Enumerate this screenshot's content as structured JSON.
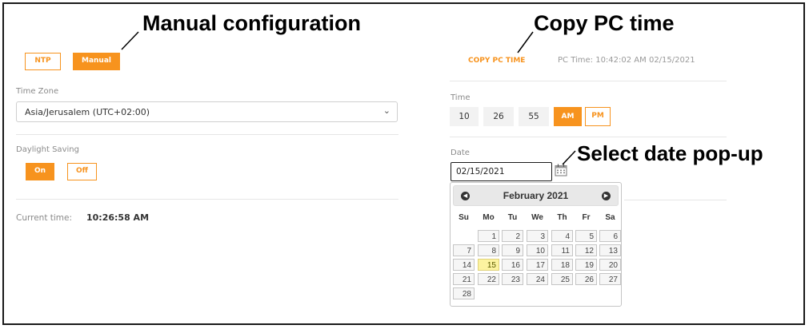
{
  "callouts": {
    "manual": "Manual configuration",
    "copy_pc": "Copy PC time",
    "date_popup": "Select date pop-up"
  },
  "mode": {
    "ntp_label": "NTP",
    "manual_label": "Manual",
    "selected": "Manual"
  },
  "timezone": {
    "label": "Time Zone",
    "value": "Asia/Jerusalem (UTC+02:00)"
  },
  "daylight": {
    "label": "Daylight Saving",
    "on_label": "On",
    "off_label": "Off",
    "selected": "On"
  },
  "current": {
    "label": "Current time:",
    "value": "10:26:58 AM"
  },
  "copy": {
    "button_label": "COPY PC TIME",
    "pc_time": "PC Time: 10:42:02 AM 02/15/2021"
  },
  "time": {
    "label": "Time",
    "hour": "10",
    "minute": "26",
    "second": "55",
    "am_label": "AM",
    "pm_label": "PM",
    "selected": "AM"
  },
  "date": {
    "label": "Date",
    "value": "02/15/2021"
  },
  "datepicker": {
    "title": "February 2021",
    "prev_icon": "circle-triangle-left-icon",
    "next_icon": "circle-triangle-right-icon",
    "weekdays": [
      "Su",
      "Mo",
      "Tu",
      "We",
      "Th",
      "Fr",
      "Sa"
    ],
    "days": [
      "1",
      "2",
      "3",
      "4",
      "5",
      "6",
      "7",
      "8",
      "9",
      "10",
      "11",
      "12",
      "13",
      "14",
      "15",
      "16",
      "17",
      "18",
      "19",
      "20",
      "21",
      "22",
      "23",
      "24",
      "25",
      "26",
      "27",
      "28"
    ],
    "first_weekday": 1,
    "highlighted": "15"
  },
  "colors": {
    "accent": "#f7931e",
    "highlight": "#fcf3a0"
  }
}
